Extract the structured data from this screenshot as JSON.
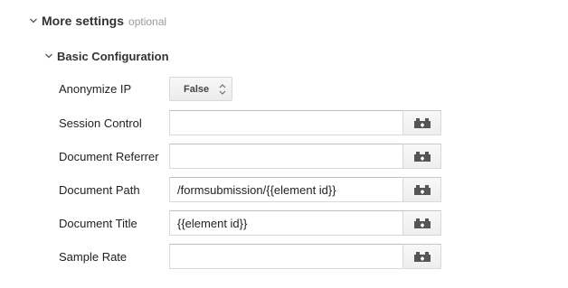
{
  "more_settings": {
    "title": "More settings",
    "subtitle": "optional",
    "chevron_icon": "chevron-down-icon"
  },
  "basic_configuration": {
    "title": "Basic Configuration",
    "chevron_icon": "chevron-down-icon"
  },
  "fields": {
    "anonymize_ip": {
      "label": "Anonymize IP",
      "value": "False",
      "icon": "select-arrows-icon"
    },
    "session_control": {
      "label": "Session Control",
      "value": "",
      "macro_icon": "macro-icon"
    },
    "document_referrer": {
      "label": "Document Referrer",
      "value": "",
      "macro_icon": "macro-icon"
    },
    "document_path": {
      "label": "Document Path",
      "value": "/formsubmission/{{element id}}",
      "macro_icon": "macro-icon"
    },
    "document_title": {
      "label": "Document Title",
      "value": "{{element id}}",
      "macro_icon": "macro-icon"
    },
    "sample_rate": {
      "label": "Sample Rate",
      "value": "",
      "macro_icon": "macro-icon"
    }
  },
  "colors": {
    "macro_icon": "#555555",
    "subtitle": "#999999"
  }
}
